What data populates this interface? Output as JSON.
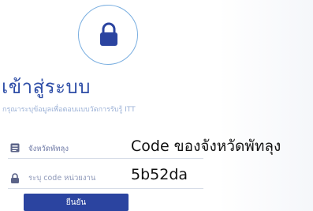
{
  "login": {
    "title": "เข้าสู่ระบบ",
    "subtitle": "กรุณาระบุข้อมูลเพื่อตอบแบบวัดการรับรู้ ITT",
    "province_value": "จังหวัดพัทลุง",
    "code_placeholder": "ระบุ code หน่วยงาน",
    "submit_label": "ยืนยัน"
  },
  "overlay": {
    "line1": "Code ของจังหวัดพัทลุง",
    "line2": "5b52da"
  },
  "colors": {
    "primary": "#2b44a0",
    "title": "#2f4ea7",
    "circle_border": "#79aee0"
  },
  "icons": {
    "lock": "lock-icon",
    "id_card": "id-card-icon",
    "small_lock": "lock-icon"
  }
}
